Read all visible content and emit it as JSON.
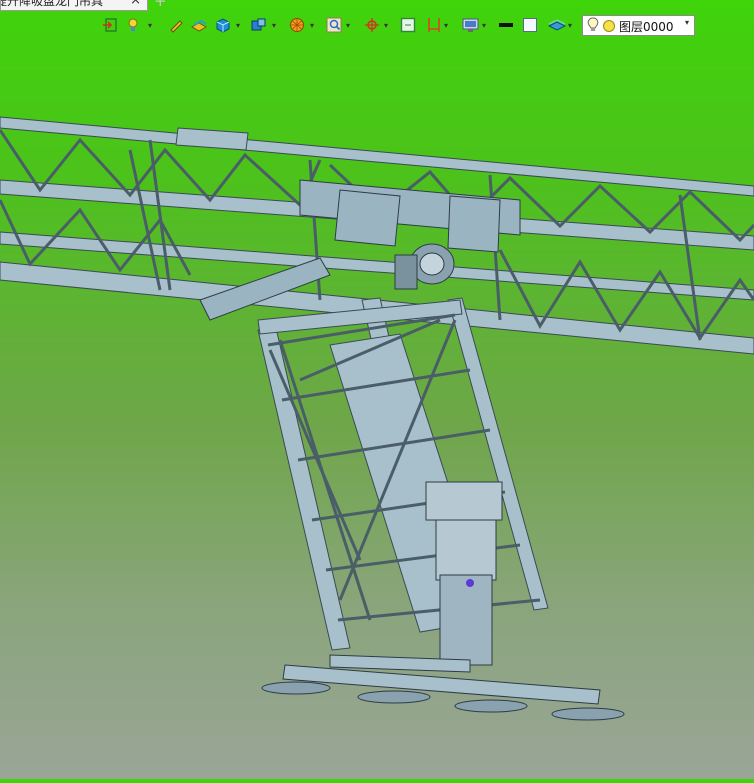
{
  "tab": {
    "title": "提升降吸盘龙门吊具",
    "close_glyph": "×",
    "add_glyph": "+"
  },
  "toolbar": {
    "buttons": [
      {
        "name": "exit-sketch-icon"
      },
      {
        "name": "light-icon",
        "dropdown": true
      },
      {
        "name": "pen-icon"
      },
      {
        "name": "extrude-icon"
      },
      {
        "name": "box-icon",
        "dropdown": true
      },
      {
        "name": "view-cube-icon",
        "dropdown": true
      },
      {
        "name": "render-style-icon",
        "dropdown": true
      },
      {
        "name": "zoom-fit-icon",
        "dropdown": true
      },
      {
        "name": "snap-icon",
        "dropdown": true
      },
      {
        "name": "frame-icon"
      },
      {
        "name": "section-icon",
        "dropdown": true
      },
      {
        "name": "display-icon",
        "dropdown": true
      },
      {
        "name": "line-weight-icon"
      },
      {
        "name": "color-swatch-icon"
      },
      {
        "name": "layer-manager-icon",
        "dropdown": true
      }
    ],
    "dropdown_glyph": "▾"
  },
  "layer": {
    "current": "图层0000",
    "arrow": "▾"
  },
  "colors": {
    "bg_top": "#3fd40a",
    "bg_bottom": "#9aa597",
    "steel": "#a8c0cc",
    "steel_dark": "#5e7886"
  }
}
